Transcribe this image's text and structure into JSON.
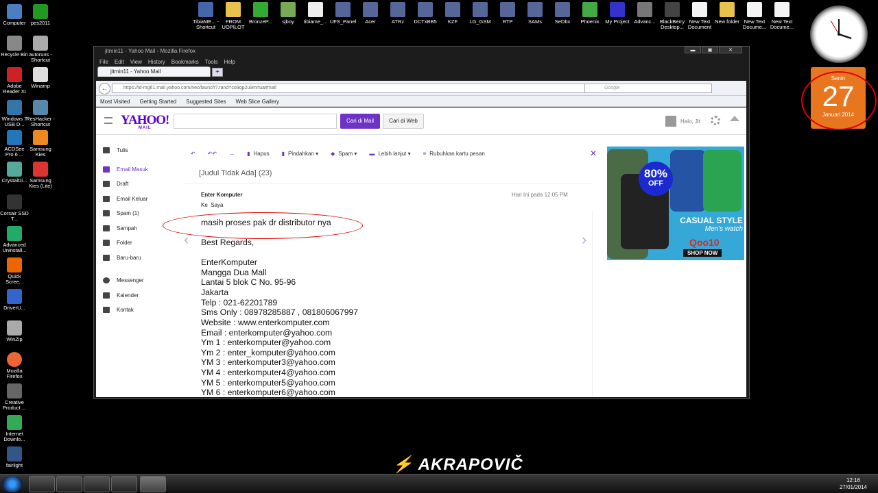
{
  "desktop": {
    "left_icons": [
      "Computer",
      "Recycle Bin",
      "Adobe Reader XI",
      "Windows 7 USB D...",
      "ACDSee Pro 6 ...",
      "CrystalDi...",
      "Corsair SSD T...",
      "Advanced Uninstall...",
      "Quick Scree...",
      "DriverU...",
      "WinZip",
      "Mozilla Firefox",
      "Creative Product ...",
      "Internet Downlo...",
      "fairlight"
    ],
    "second_icons": [
      "pes2011",
      "autoruns - Shortcut",
      "Winamp",
      "ResHacker - Shortcut",
      "Samsung Kies",
      "Samsung Kies (Lite)"
    ],
    "top_icons": [
      "TibiaME... - Shortcut",
      "FROM UOPILOT",
      "BronzeP...",
      "sjboy",
      "tibiame_...",
      "UFS_Panel",
      "Acer",
      "ATRz",
      "DCTxBB5",
      "KZF",
      "LG_GSM",
      "RTP",
      "SAMs",
      "SeDbx",
      "Phoenix",
      "My Project",
      "Advanc...",
      "BlackBerry Desktop...",
      "New Text Document",
      "New folder",
      "New Text Docume...",
      "New Text Docume..."
    ]
  },
  "calendar": {
    "day": "Senin",
    "date": "27",
    "month": "Januari 2014"
  },
  "window": {
    "title": "jitmin11 - Yahoo Mail - Mozilla Firefox",
    "min": "▬",
    "max": "▣",
    "close": "✕"
  },
  "menu": [
    "File",
    "Edit",
    "View",
    "History",
    "Bookmarks",
    "Tools",
    "Help"
  ],
  "tab": {
    "label": "jitmin11 - Yahoo Mail",
    "new": "+"
  },
  "nav": {
    "back": "←",
    "url": "https://id-mg61.mail.yahoo.com/neo/launch?.rand=co9qp2u9mrtua#mail",
    "search_placeholder": "Google"
  },
  "bookmarks": [
    "Most Visited",
    "Getting Started",
    "Suggested Sites",
    "Web Slice Gallery"
  ],
  "yahoo": {
    "logo": "YAHOO!",
    "logo_sub": "MAIL",
    "search_mail": "Cari di Mail",
    "search_web": "Cari di Web",
    "user": "Halo, Jit"
  },
  "sidebar": [
    "Tulis",
    "Email Masuk",
    "Draft",
    "Email Keluar",
    "Spam (1)",
    "Sampah",
    "Folder",
    "Baru-baru",
    "Messenger",
    "Kalender",
    "Kontak"
  ],
  "toolbar": {
    "delete": "Hapus",
    "move": "Pindahkan",
    "spam": "Spam",
    "more": "Lebih lanjut",
    "summarize": "Rubuhkan kartu pesan"
  },
  "message": {
    "subject": "[Judul Tidak Ada] (23)",
    "sender": "Enter Komputer",
    "recipient_prefix": "Ke",
    "recipient": "Saya",
    "date": "Hari Ini pada 12:05 PM",
    "body": [
      "masih proses pak dr distributor nya",
      "",
      "Best Regards,",
      "",
      "EnterKomputer",
      "Mangga Dua Mall",
      "Lantai 5 blok C No. 95-96",
      "Jakarta",
      "Telp : 021-62201789",
      "Sms Only : 08978285887 , 081806067997",
      "Website : www.enterkomputer.com",
      "Email : enterkomputer@yahoo.com",
      "Ym 1 : enterkomputer@yahoo.com",
      "Ym 2 : enter_komputer@yahoo.com",
      "YM 3 : enterkomputer3@yahoo.com",
      "YM 4 : enterkomputer4@yahoo.com",
      "YM 5 : enterkomputer5@yahoo.com",
      "YM 6 : enterkomputer6@yahoo.com"
    ]
  },
  "ad": {
    "badge_pct": "80%",
    "badge_off": "OFF",
    "line1": "CASUAL STYLE",
    "line2": "Men's watch",
    "brand": "Qoo10",
    "cta": "SHOP NOW"
  },
  "wallpaper_logo": "AKRAPOVIČ",
  "tray": {
    "time": "12:16",
    "date": "27/01/2014"
  },
  "colors": {
    "accent": "#6d33c6",
    "annotation": "#dd0000",
    "calendar": "#e8761e"
  }
}
